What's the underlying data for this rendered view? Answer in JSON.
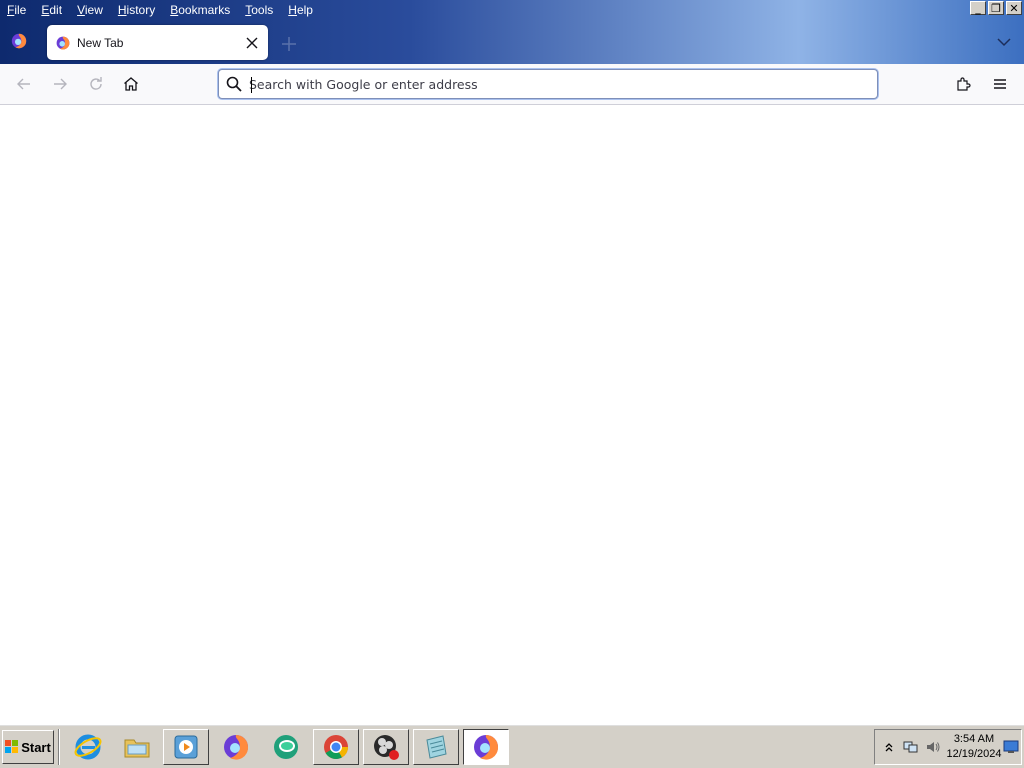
{
  "menubar": {
    "items": [
      "File",
      "Edit",
      "View",
      "History",
      "Bookmarks",
      "Tools",
      "Help"
    ]
  },
  "window_controls": {
    "minimize": "_",
    "restore": "❐",
    "close": "✕"
  },
  "tabs": [
    {
      "title": "New Tab",
      "icon": "firefox-icon",
      "active": true
    }
  ],
  "urlbar": {
    "placeholder": "Search with Google or enter address",
    "value": ""
  },
  "taskbar": {
    "start_label": "Start",
    "apps": [
      "internet-explorer-icon",
      "file-explorer-icon",
      "media-player-icon",
      "firefox-icon",
      "green-chat-icon",
      "chrome-icon",
      "obs-icon",
      "notepad-icon",
      "firefox-icon"
    ],
    "clock_time": "3:54 AM",
    "clock_date": "12/19/2024"
  },
  "colors": {
    "accent": "#0061e0",
    "title_gradient_start": "#0e2a6e",
    "title_gradient_end": "#8fb3e6"
  }
}
